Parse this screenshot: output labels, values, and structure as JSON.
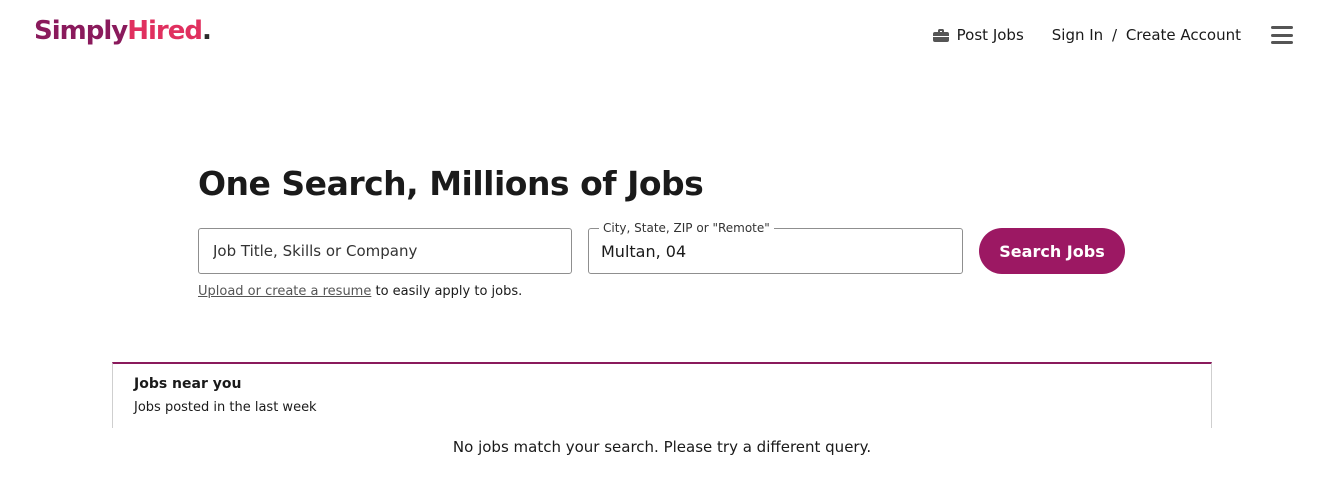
{
  "brand": {
    "logo_part1": "Simply",
    "logo_part2": "Hired",
    "logo_part3": ".",
    "colors": {
      "primary": "#9c1863",
      "accent": "#e0305f"
    }
  },
  "nav": {
    "post_jobs": "Post Jobs",
    "sign_in": "Sign In",
    "separator": "/",
    "create_account": "Create Account",
    "icons": [
      "briefcase-icon",
      "hamburger-menu-icon"
    ]
  },
  "hero": {
    "title": "One Search, Millions of Jobs"
  },
  "search": {
    "what_placeholder": "Job Title, Skills or Company",
    "what_value": "",
    "where_label": "City, State, ZIP or \"Remote\"",
    "where_value": "Multan, 04",
    "button_label": "Search Jobs"
  },
  "resume": {
    "link_text": "Upload or create a resume",
    "suffix": " to easily apply to jobs."
  },
  "jobs_panel": {
    "title": "Jobs near you",
    "subtitle": "Jobs posted in the last week",
    "empty_message": "No jobs match your search. Please try a different query."
  }
}
